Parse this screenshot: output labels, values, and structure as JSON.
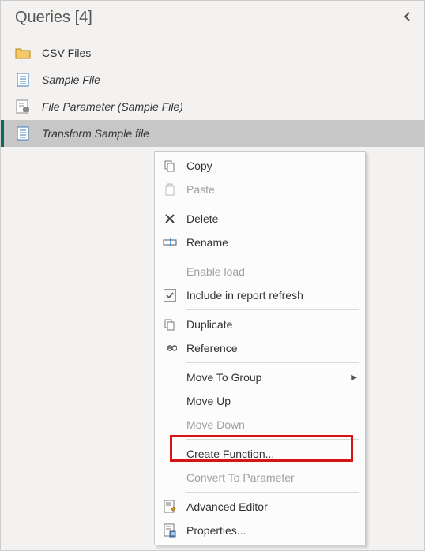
{
  "panel": {
    "title": "Queries [4]"
  },
  "queries": [
    {
      "label": "CSV Files",
      "icon": "folder",
      "italic": false
    },
    {
      "label": "Sample File",
      "icon": "doc",
      "italic": true
    },
    {
      "label": "File Parameter (Sample File)",
      "icon": "param",
      "italic": true
    },
    {
      "label": "Transform Sample file",
      "icon": "doc",
      "italic": true
    }
  ],
  "menu": {
    "copy": "Copy",
    "paste": "Paste",
    "delete": "Delete",
    "rename": "Rename",
    "enable_load": "Enable load",
    "include_refresh": "Include in report refresh",
    "duplicate": "Duplicate",
    "reference": "Reference",
    "move_to_group": "Move To Group",
    "move_up": "Move Up",
    "move_down": "Move Down",
    "create_function": "Create Function...",
    "convert_param": "Convert To Parameter",
    "adv_editor": "Advanced Editor",
    "properties": "Properties..."
  }
}
